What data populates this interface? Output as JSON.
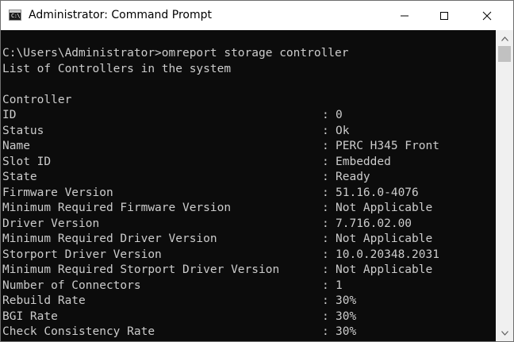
{
  "window": {
    "title": "Administrator: Command Prompt",
    "icon": "cmd-icon",
    "icon_glyph": "C:\\",
    "controls": {
      "minimize": "minimize-icon",
      "maximize": "maximize-icon",
      "close": "close-icon"
    }
  },
  "console": {
    "command_line": "C:\\Users\\Administrator>omreport storage controller",
    "header": "List of Controllers in the system",
    "section": "Controller",
    "separator": ":",
    "rows": [
      {
        "label": "ID",
        "value": "0"
      },
      {
        "label": "Status",
        "value": "Ok"
      },
      {
        "label": "Name",
        "value": "PERC H345 Front"
      },
      {
        "label": "Slot ID",
        "value": "Embedded"
      },
      {
        "label": "State",
        "value": "Ready"
      },
      {
        "label": "Firmware Version",
        "value": "51.16.0-4076"
      },
      {
        "label": "Minimum Required Firmware Version",
        "value": "Not Applicable"
      },
      {
        "label": "Driver Version",
        "value": "7.716.02.00"
      },
      {
        "label": "Minimum Required Driver Version",
        "value": "Not Applicable"
      },
      {
        "label": "Storport Driver Version",
        "value": "10.0.20348.2031"
      },
      {
        "label": "Minimum Required Storport Driver Version",
        "value": "Not Applicable"
      },
      {
        "label": "Number of Connectors",
        "value": "1"
      },
      {
        "label": "Rebuild Rate",
        "value": "30%"
      },
      {
        "label": "BGI Rate",
        "value": "30%"
      },
      {
        "label": "Check Consistency Rate",
        "value": "30%"
      }
    ]
  },
  "colors": {
    "console_bg": "#0c0c0c",
    "console_text": "#cccccc",
    "titlebar_bg": "#ffffff",
    "scrollbar_bg": "#f0f0f0",
    "scrollbar_thumb": "#c1c1c1"
  }
}
